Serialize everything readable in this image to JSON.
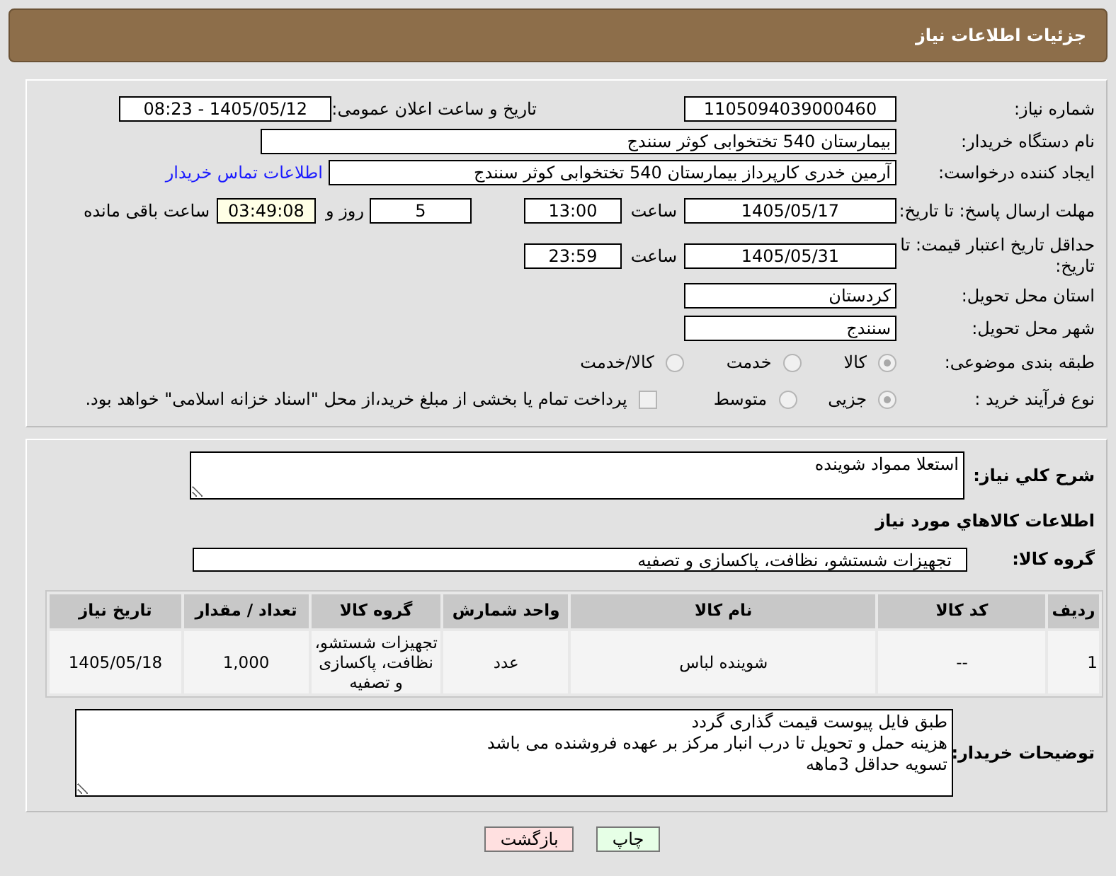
{
  "header": {
    "title": "جزئیات اطلاعات نیاز"
  },
  "need_number": {
    "label": "شماره نیاز:",
    "value": "1105094039000460"
  },
  "announce_datetime": {
    "label": "تاریخ و ساعت اعلان عمومی:",
    "value": "1405/05/12 - 08:23"
  },
  "buyer_org": {
    "label": "نام دستگاه خریدار:",
    "value": "بیمارستان 540 تختخوابی کوثر سنندج"
  },
  "requester": {
    "label": "ایجاد کننده درخواست:",
    "value": "آرمین خدری کارپرداز بیمارستان 540 تختخوابی کوثر سنندج",
    "contact_link": "اطلاعات تماس خریدار"
  },
  "reply_deadline": {
    "label": "مهلت ارسال پاسخ: تا تاریخ:",
    "date": "1405/05/17",
    "time_label": "ساعت",
    "time": "13:00",
    "days": "5",
    "days_label": "روز و",
    "remaining": "03:49:08",
    "remaining_label": "ساعت باقی مانده"
  },
  "price_validity": {
    "label": "حداقل تاریخ اعتبار قیمت: تا تاریخ:",
    "date": "1405/05/31",
    "time_label": "ساعت",
    "time": "23:59"
  },
  "delivery_province": {
    "label": "استان محل تحویل:",
    "value": "کردستان"
  },
  "delivery_city": {
    "label": "شهر محل تحویل:",
    "value": "سنندج"
  },
  "subject_category": {
    "label": "طبقه بندی موضوعی:",
    "options": [
      {
        "label": "کالا",
        "selected": true
      },
      {
        "label": "خدمت",
        "selected": false
      },
      {
        "label": "کالا/خدمت",
        "selected": false
      }
    ]
  },
  "purchase_process": {
    "label": "نوع فرآیند خرید :",
    "options": [
      {
        "label": "جزیی",
        "selected": true
      },
      {
        "label": "متوسط",
        "selected": false
      }
    ],
    "treasury": {
      "label": "پرداخت تمام یا بخشی از مبلغ خرید،از محل \"اسناد خزانه اسلامی\" خواهد بود.",
      "checked": false
    }
  },
  "description": {
    "label": "شرح کلي نياز:",
    "value": "استعلا ممواد شوینده"
  },
  "items_title": "اطلاعات کالاهاي مورد نياز",
  "goods_group": {
    "label": "گروه کالا:",
    "value": "تجهیزات شستشو، نظافت، پاکسازی و تصفیه"
  },
  "table": {
    "columns": [
      "ردیف",
      "کد کالا",
      "نام کالا",
      "واحد شمارش",
      "گروه کالا",
      "تعداد / مقدار",
      "تاریخ نیاز"
    ],
    "rows": [
      [
        "1",
        "--",
        "شوینده لباس",
        "عدد",
        "تجهیزات شستشو، نظافت، پاکسازی و تصفیه",
        "1,000",
        "1405/05/18"
      ]
    ]
  },
  "buyer_notes": {
    "label": "توضیحات خریدار:",
    "value": "طبق فایل پیوست قیمت گذاری گردد\nهزینه حمل و تحویل تا درب انبار مرکز بر عهده فروشنده می باشد\nتسویه حداقل 3ماهه"
  },
  "buttons": [
    {
      "label": "چاپ",
      "kind": "print"
    },
    {
      "label": "بازگشت",
      "kind": "back"
    }
  ]
}
